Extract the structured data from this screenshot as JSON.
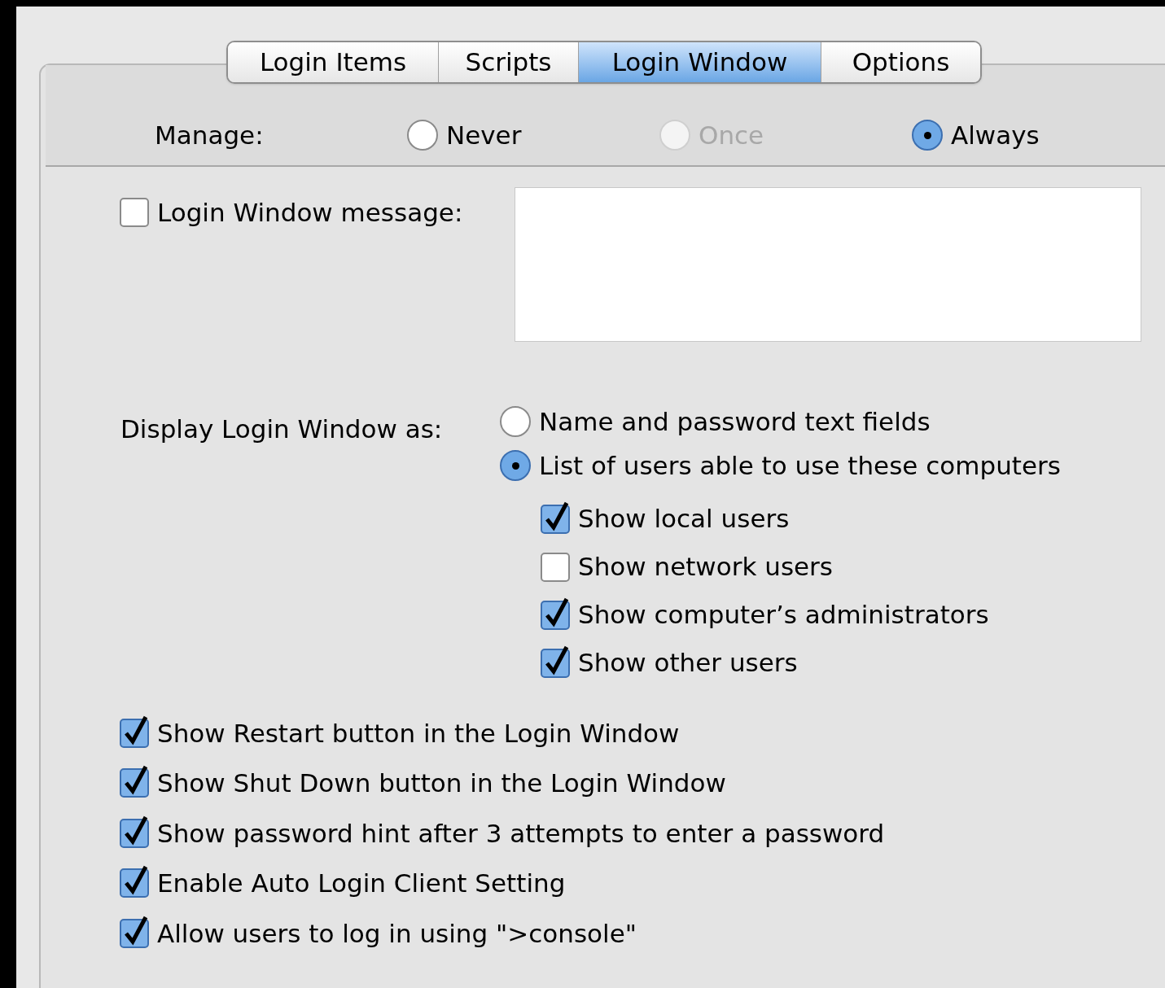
{
  "tabs": [
    {
      "label": "Login Items",
      "selected": false
    },
    {
      "label": "Scripts",
      "selected": false
    },
    {
      "label": "Login Window",
      "selected": true
    },
    {
      "label": "Options",
      "selected": false
    }
  ],
  "manage": {
    "label": "Manage:",
    "options": [
      {
        "label": "Never",
        "selected": false,
        "disabled": false
      },
      {
        "label": "Once",
        "selected": false,
        "disabled": true
      },
      {
        "label": "Always",
        "selected": true,
        "disabled": false
      }
    ]
  },
  "message": {
    "label": "Login Window message:",
    "checked": false
  },
  "display": {
    "label": "Display Login Window as:",
    "options": [
      {
        "label": "Name and password text fields",
        "selected": false
      },
      {
        "label": "List of users able to use these computers",
        "selected": true
      }
    ],
    "sub_options": [
      {
        "label": "Show local users",
        "checked": true
      },
      {
        "label": "Show network users",
        "checked": false
      },
      {
        "label": "Show computer’s administrators",
        "checked": true
      },
      {
        "label": "Show other users",
        "checked": true
      }
    ]
  },
  "options": [
    {
      "label": "Show Restart button in the Login Window",
      "checked": true
    },
    {
      "label": "Show Shut Down button in the Login Window",
      "checked": true
    },
    {
      "label": "Show password hint after 3 attempts to enter a password",
      "checked": true
    },
    {
      "label": "Enable Auto Login Client Setting",
      "checked": true
    },
    {
      "label": "Allow users to log in using \">console\"",
      "checked": true
    }
  ]
}
